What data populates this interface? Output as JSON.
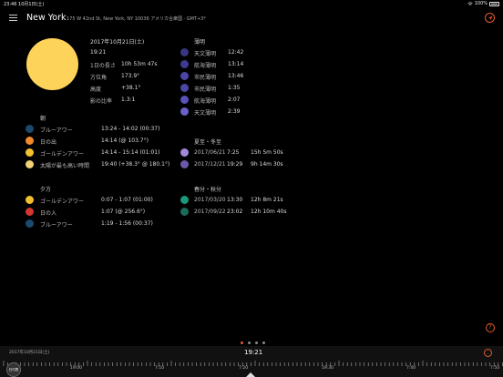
{
  "status": {
    "time": "23:46",
    "date": "10月1日(土)",
    "battery": "100%"
  },
  "header": {
    "city": "New York",
    "address": "175 W 42nd St, New York, NY 10036 アメリカ合衆国 · GMT+3*"
  },
  "sun_info": {
    "date": "2017年10月21日(土)",
    "time": "19:21",
    "rows": [
      {
        "label": "1日の長さ",
        "value": "10h 53m 47s"
      },
      {
        "label": "方位角",
        "value": "173.9°"
      },
      {
        "label": "高度",
        "value": "+38.1°"
      },
      {
        "label": "影の比率",
        "value": "1.3:1"
      }
    ]
  },
  "twilight": {
    "title": "薄明",
    "rows": [
      {
        "label": "天文薄明",
        "value": "12:42",
        "color": "#3a3580"
      },
      {
        "label": "航海薄明",
        "value": "13:14",
        "color": "#403a90"
      },
      {
        "label": "市民薄明",
        "value": "13:46",
        "color": "#4c46a6"
      },
      {
        "label": "市民薄明",
        "value": "1:35",
        "color": "#4c46a6"
      },
      {
        "label": "航海薄明",
        "value": "2:07",
        "color": "#5a52b8"
      },
      {
        "label": "天文薄明",
        "value": "2:39",
        "color": "#6a60c8"
      }
    ]
  },
  "morning": {
    "title": "朝",
    "rows": [
      {
        "label": "ブルーアワー",
        "value": "13:24 - 14:02 (00:37)",
        "color": "#1b4a6e"
      },
      {
        "label": "日の出",
        "value": "14:14 (@ 103.7°)",
        "color": "#f28b2c"
      },
      {
        "label": "ゴールデンアワー",
        "value": "14:14 - 15:14 (01:01)",
        "color": "#f3c02f"
      },
      {
        "label": "太陽が最も高い時間",
        "value": "19:40 (+38.3° @ 180.1°)",
        "color": "#f0d27a"
      }
    ]
  },
  "solstice": {
    "title": "夏至・冬至",
    "rows": [
      {
        "date": "2017/06/21",
        "time": "7:25",
        "duration": "15h 5m 50s",
        "color": "#a18ad8"
      },
      {
        "date": "2017/12/21",
        "time": "19:29",
        "duration": "9h 14m 30s",
        "color": "#6c58a8"
      }
    ]
  },
  "evening": {
    "title": "夕方",
    "rows": [
      {
        "label": "ゴールデンアワー",
        "value": "0:07 - 1:07 (01:00)",
        "color": "#f3c02f"
      },
      {
        "label": "日の入",
        "value": "1:07 (@ 256.6°)",
        "color": "#d4372f"
      },
      {
        "label": "ブルーアワー",
        "value": "1:19 - 1:56 (00:37)",
        "color": "#1b4a6e"
      }
    ]
  },
  "equinox": {
    "title": "春分・秋分",
    "rows": [
      {
        "date": "2017/03/20",
        "time": "13:30",
        "duration": "12h 8m 21s",
        "color": "#1a9a7a"
      },
      {
        "date": "2017/09/22",
        "time": "23:02",
        "duration": "12h 10m 40s",
        "color": "#1e6a5a"
      }
    ]
  },
  "timeline": {
    "date": "2017年10月21日(土)",
    "now": "19:21",
    "badge": "日付表示",
    "ticks": [
      "19:00",
      "7:10",
      "7:20",
      "19:30",
      "7:40",
      "7:50"
    ]
  }
}
